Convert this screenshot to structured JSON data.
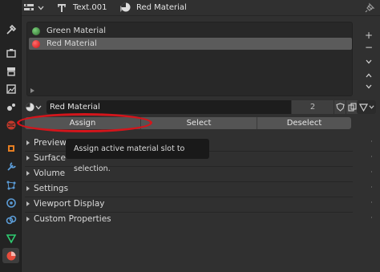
{
  "header": {
    "object_name": "Text.001",
    "material_name": "Red Material"
  },
  "material_slots": [
    {
      "name": "Green Material",
      "color": "#3a7a3a",
      "selected": false
    },
    {
      "name": "Red Material",
      "color": "#e02020",
      "selected": true
    }
  ],
  "material_selector": {
    "name": "Red Material",
    "users": "2"
  },
  "actions": {
    "assign": "Assign",
    "select": "Select",
    "deselect": "Deselect"
  },
  "tooltip": "Assign active material slot to selection.",
  "panels": [
    {
      "label": "Preview"
    },
    {
      "label": "Surface"
    },
    {
      "label": "Volume"
    },
    {
      "label": "Settings"
    },
    {
      "label": "Viewport Display"
    },
    {
      "label": "Custom Properties"
    }
  ],
  "tabs": [
    "tool-icon",
    "render-icon",
    "output-icon",
    "view-layer-icon",
    "scene-icon",
    "world-icon",
    "object-icon",
    "modifier-icon",
    "particles-icon",
    "physics-icon",
    "constraints-icon",
    "data-icon",
    "material-icon"
  ],
  "colors": {
    "highlight_ellipse": "#d4151b",
    "selected_slot": "#5b5b5b",
    "background": "#303030"
  }
}
